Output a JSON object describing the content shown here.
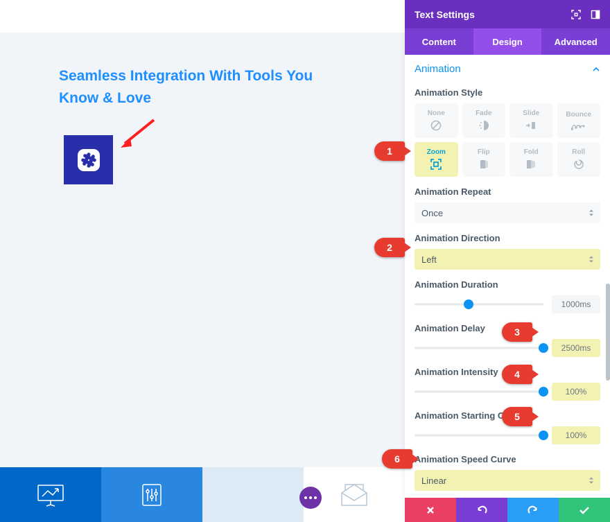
{
  "preview": {
    "headline": "Seamless Integration With Tools You Know & Love"
  },
  "panel": {
    "title": "Text Settings",
    "tabs": {
      "content": "Content",
      "design": "Design",
      "advanced": "Advanced"
    },
    "section": "Animation",
    "labels": {
      "style": "Animation Style",
      "repeat": "Animation Repeat",
      "direction": "Animation Direction",
      "duration": "Animation Duration",
      "delay": "Animation Delay",
      "intensity": "Animation Intensity",
      "opacity": "Animation Starting Opacity",
      "curve": "Animation Speed Curve"
    },
    "styles": [
      {
        "key": "none",
        "label": "None"
      },
      {
        "key": "fade",
        "label": "Fade"
      },
      {
        "key": "slide",
        "label": "Slide"
      },
      {
        "key": "bounce",
        "label": "Bounce"
      },
      {
        "key": "zoom",
        "label": "Zoom"
      },
      {
        "key": "flip",
        "label": "Flip"
      },
      {
        "key": "fold",
        "label": "Fold"
      },
      {
        "key": "roll",
        "label": "Roll"
      }
    ],
    "values": {
      "repeat": "Once",
      "direction": "Left",
      "duration": "1000ms",
      "delay": "2500ms",
      "intensity": "100%",
      "opacity": "100%",
      "curve": "Linear"
    },
    "sliders": {
      "duration_pct": 42,
      "delay_pct": 100,
      "intensity_pct": 100,
      "opacity_pct": 100
    }
  },
  "callouts": [
    "1",
    "2",
    "3",
    "4",
    "5",
    "6"
  ],
  "colors": {
    "purple": "#7b3ed4",
    "blue": "#0b93f6",
    "highlight": "#f4f2b3",
    "callout": "#e63b2e"
  }
}
